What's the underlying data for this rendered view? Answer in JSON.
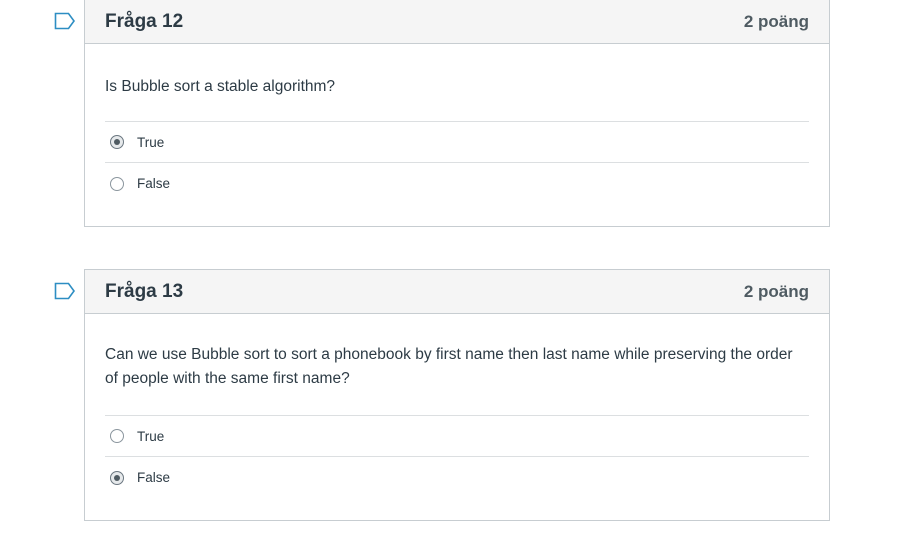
{
  "questions": [
    {
      "title": "Fråga 12",
      "points": "2 poäng",
      "text": "Is Bubble sort a stable algorithm?",
      "answers": [
        {
          "label": "True",
          "selected": true
        },
        {
          "label": "False",
          "selected": false
        }
      ]
    },
    {
      "title": "Fråga 13",
      "points": "2 poäng",
      "text": "Can we use Bubble sort to sort a phonebook by first name then last name while preserving the order of people with the same first name?",
      "answers": [
        {
          "label": "True",
          "selected": false
        },
        {
          "label": "False",
          "selected": true
        }
      ]
    }
  ],
  "icons": {
    "flag": "flag-outline-icon",
    "radio_selected": "radio-selected-icon",
    "radio_unselected": "radio-unselected-icon"
  },
  "colors": {
    "flag": "#2d8ec3",
    "header_bg": "#f5f5f5",
    "border": "#c7cdd1",
    "text": "#2d3b45"
  }
}
